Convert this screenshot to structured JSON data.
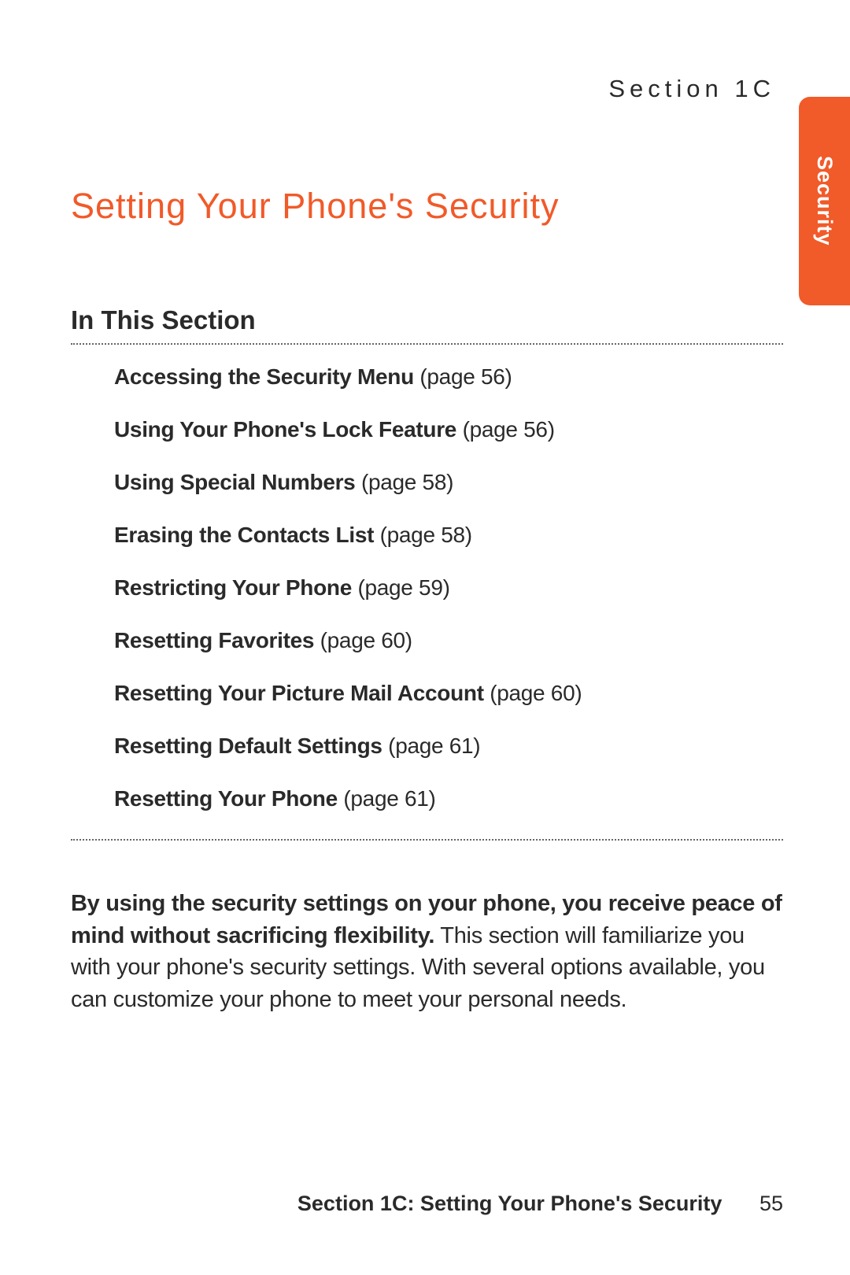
{
  "header": {
    "section_label": "Section 1C"
  },
  "side_tab": {
    "label": "Security"
  },
  "title": "Setting Your Phone's Security",
  "in_this_section": {
    "heading": "In This Section",
    "items": [
      {
        "title": "Accessing the Security Menu",
        "page_ref": "(page 56)"
      },
      {
        "title": "Using Your Phone's Lock Feature",
        "page_ref": "(page 56)"
      },
      {
        "title": "Using Special Numbers",
        "page_ref": "(page 58)"
      },
      {
        "title": "Erasing the Contacts List",
        "page_ref": "(page 58)"
      },
      {
        "title": "Restricting Your Phone",
        "page_ref": "(page 59)"
      },
      {
        "title": "Resetting Favorites",
        "page_ref": "(page 60)"
      },
      {
        "title": "Resetting Your Picture Mail Account",
        "page_ref": "(page 60)"
      },
      {
        "title": "Resetting Default Settings",
        "page_ref": "(page 61)"
      },
      {
        "title": "Resetting Your Phone",
        "page_ref": "(page 61)"
      }
    ]
  },
  "intro": {
    "bold_part": "By using the security settings on your phone, you receive peace of mind without sacrificing flexibility.",
    "rest_part": " This section will familiarize you with your phone's security settings. With several options available, you can customize your phone to meet your personal needs."
  },
  "footer": {
    "text": "Section 1C: Setting Your Phone's Security",
    "page_number": "55"
  }
}
